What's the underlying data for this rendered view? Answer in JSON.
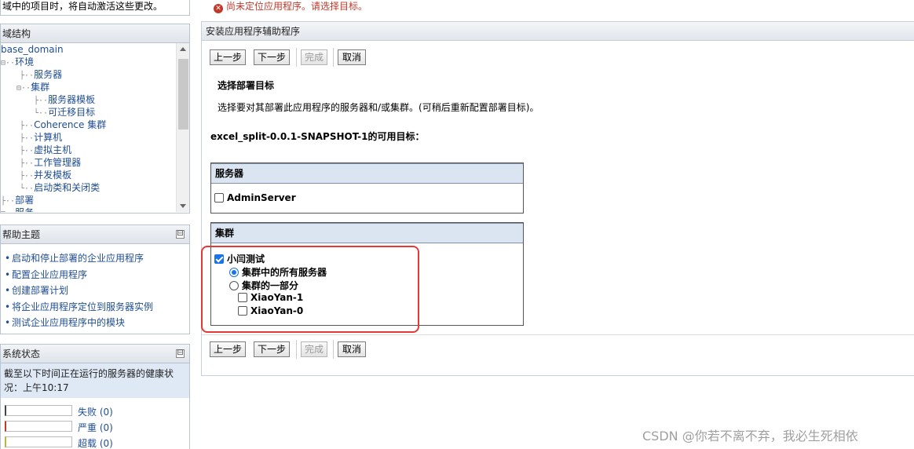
{
  "left": {
    "top_note": "域中的项目时，将自动激活这些更改。",
    "tree": {
      "title": "域结构",
      "nodes": [
        {
          "label": "base_domain",
          "prefix": ""
        },
        {
          "label": "环境",
          "prefix": "⊟··"
        },
        {
          "label": "服务器",
          "prefix": "├··"
        },
        {
          "label": "集群",
          "prefix": "⊟··"
        },
        {
          "label": "服务器模板",
          "prefix": "├··"
        },
        {
          "label": "可迁移目标",
          "prefix": "└··"
        },
        {
          "label": "Coherence 集群",
          "prefix": "├··"
        },
        {
          "label": "计算机",
          "prefix": "├··"
        },
        {
          "label": "虚拟主机",
          "prefix": "├··"
        },
        {
          "label": "工作管理器",
          "prefix": "├··"
        },
        {
          "label": "并发模板",
          "prefix": "├··"
        },
        {
          "label": "启动类和关闭类",
          "prefix": "└··"
        },
        {
          "label": "部署",
          "prefix": "├··"
        },
        {
          "label": "服务",
          "prefix": "⊞··"
        }
      ]
    },
    "help": {
      "title": "帮助主题",
      "collapse_icon": "⊟",
      "items": [
        "启动和停止部署的企业应用程序",
        "配置企业应用程序",
        "创建部署计划",
        "将企业应用程序定位到服务器实例",
        "测试企业应用程序中的模块"
      ]
    },
    "status": {
      "title": "系统状态",
      "collapse_icon": "⊟",
      "description": "截至以下时间正在运行的服务器的健康状况：上午10:17",
      "rows": [
        {
          "label": "失败 (0)",
          "color": "#444444"
        },
        {
          "label": "严重 (0)",
          "color": "#c0392b"
        },
        {
          "label": "超载 (0)",
          "color": "#b5b83a"
        }
      ]
    }
  },
  "main": {
    "error": "尚未定位应用程序。请选择目标。",
    "wizard_title": "安装应用程序辅助程序",
    "buttons": {
      "prev": "上一步",
      "next": "下一步",
      "finish": "完成",
      "cancel": "取消"
    },
    "section_title": "选择部署目标",
    "description": "选择要对其部署此应用程序的服务器和/或集群。(可稍后重新配置部署目标)。",
    "targets_title": "excel_split-0.0.1-SNAPSHOT-1的可用目标：",
    "servers": {
      "header": "服务器",
      "items": [
        {
          "label": "AdminServer",
          "checked": false
        }
      ]
    },
    "clusters": {
      "header": "集群",
      "cluster_name": "小闫测试",
      "cluster_checked": true,
      "option_all": "集群中的所有服务器",
      "option_part": "集群的一部分",
      "members": [
        "XiaoYan-1",
        "XiaoYan-0"
      ]
    }
  },
  "watermark": "CSDN @你若不离不弃，我必生死相依"
}
